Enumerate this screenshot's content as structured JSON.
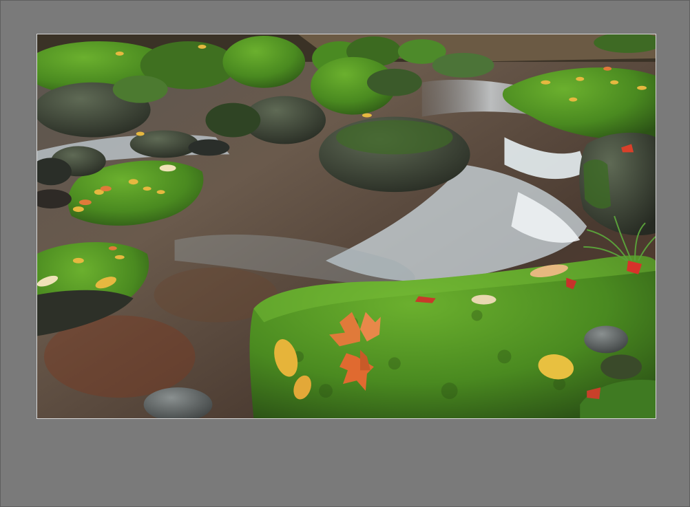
{
  "scene": {
    "subject": "mossy-stream-with-autumn-leaves",
    "colors": {
      "frame": "#7a7a7a",
      "photo_border": "#d9d9d9",
      "moss": "#4f8f24",
      "moss_dark": "#2f5e1a",
      "water": "#c8d4dc",
      "water_dark": "#4a4038",
      "leaf_orange": "#e07a3a",
      "leaf_yellow": "#e6b43a",
      "leaf_red": "#c8322a"
    }
  }
}
